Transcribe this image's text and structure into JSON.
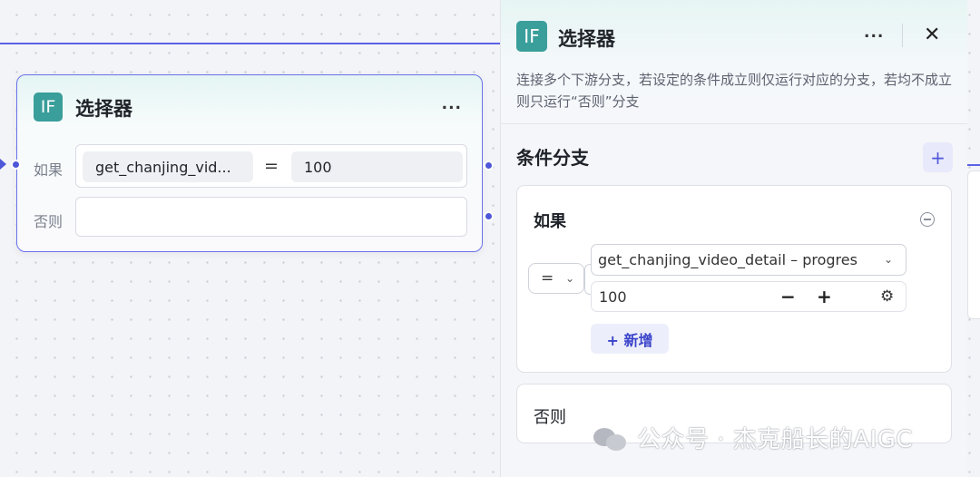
{
  "node": {
    "icon_text": "IF",
    "title": "选择器",
    "more": "...",
    "if_label": "如果",
    "condition_variable": "get_chanjing_vid...",
    "condition_operator": "=",
    "condition_value": "100",
    "else_label": "否则"
  },
  "panel": {
    "icon_text": "IF",
    "title": "选择器",
    "more": "...",
    "close": "✕",
    "description": "连接多个下游分支，若设定的条件成立则仅运行对应的分支，若均不成立则只运行“否则”分支",
    "section_title": "条件分支",
    "add_branch": "+",
    "if_branch": {
      "title": "如果",
      "operator": "=",
      "variable": "get_chanjing_video_detail – progres",
      "value": "100",
      "minus": "−",
      "plus": "+",
      "add_condition": "+ 新增"
    },
    "else_branch": {
      "title": "否则"
    }
  },
  "watermark": {
    "text": "公众号 · 杰克船长的AIGC"
  },
  "colors": {
    "accent": "#4e56d9",
    "if_icon": "#3a9e9a",
    "edge": "#5a63e6"
  }
}
